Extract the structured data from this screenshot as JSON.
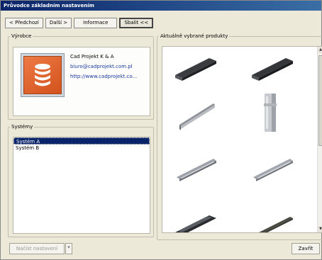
{
  "window": {
    "title": "Průvodce základním nastavením"
  },
  "toolbar": {
    "prev_label": "< Předchozí",
    "next_label": "Další >",
    "info_label": "Informace",
    "collapse_label": "Sbalit <<"
  },
  "manufacturer": {
    "legend": "Výrobce",
    "name": "Cad Projekt K & A",
    "email": "biuro@cadprojekt.com.pl",
    "website": "http://www.cadprojekt.co...",
    "logo_icon": "database-icon",
    "logo_color": "#e26a33"
  },
  "systems": {
    "legend": "Systémy",
    "items": [
      "Systém A",
      "Systém B"
    ],
    "selected": "Systém A"
  },
  "products": {
    "legend": "Aktuálně vybrané produkty",
    "thumbnails": [
      "profile-channel-icon",
      "profile-channel-icon",
      "profile-angle-icon",
      "profile-tube-icon",
      "profile-rail-icon",
      "profile-rail-icon",
      "profile-channel-icon",
      "profile-rail-icon"
    ]
  },
  "footer": {
    "load_settings_label": "Načíst nastavení",
    "close_label": "Zavřít"
  },
  "colors": {
    "selection": "#0a246a",
    "link": "#1a3aa0",
    "dialog_bg": "#ece9d8"
  }
}
